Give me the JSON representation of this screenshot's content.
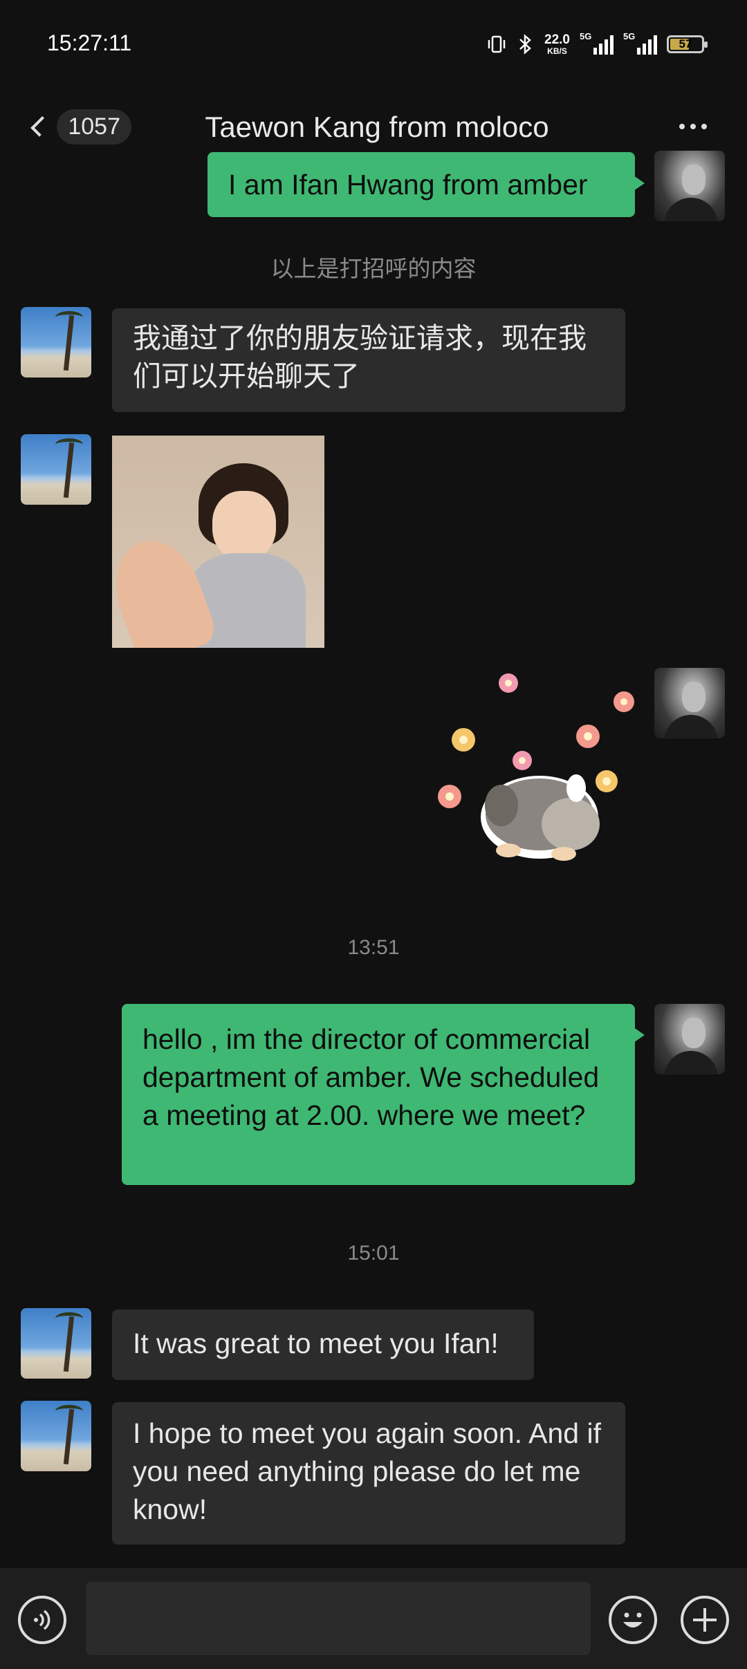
{
  "status_bar": {
    "time": "15:27:11",
    "net_speed_value": "22.0",
    "net_speed_unit": "KB/S",
    "signal1_tag": "5G",
    "signal2_tag": "5G",
    "battery_level": "57",
    "icons": [
      "vibrate-icon",
      "bluetooth-icon",
      "signal-icon",
      "signal-icon",
      "battery-icon"
    ]
  },
  "header": {
    "unread_count": "1057",
    "title": "Taewon Kang from moloco"
  },
  "messages": {
    "m1": "I am Ifan Hwang from  amber",
    "sys_note": "以上是打招呼的内容",
    "m2": "我通过了你的朋友验证请求，现在我们可以开始聊天了",
    "ts1": "13:51",
    "m3": "hello , im the director  of commercial department of amber. We scheduled a meeting  at  2.00. where  we  meet?",
    "ts2": "15:01",
    "m4": "It was great to meet you Ifan!",
    "m5": "I hope to meet you again soon. And if you need anything please do let me know!"
  },
  "input_bar": {
    "value": "",
    "icons": [
      "voice-icon",
      "emoji-icon",
      "plus-icon"
    ]
  },
  "colors": {
    "background": "#111111",
    "incoming_bubble": "#2c2c2c",
    "outgoing_bubble": "#3fb873",
    "input_bar": "#1e1e1e"
  }
}
